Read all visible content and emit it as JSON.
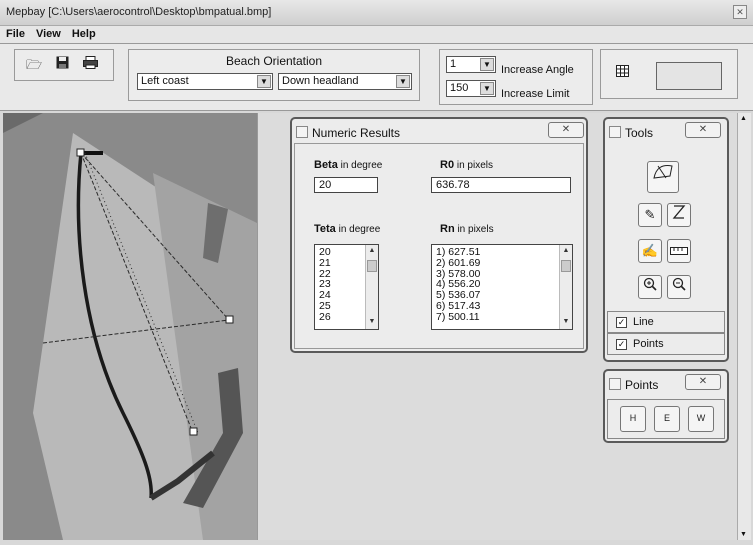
{
  "window": {
    "title": "Mepbay [C:\\Users\\aerocontrol\\Desktop\\bmpatual.bmp]"
  },
  "menu": [
    "File",
    "View",
    "Help"
  ],
  "beach_orientation": {
    "label": "Beach Orientation",
    "coast": "Left coast",
    "headland": "Down headland"
  },
  "angle_controls": {
    "angle_value": "1",
    "angle_label": "Increase Angle",
    "limit_value": "150",
    "limit_label": "Increase Limit"
  },
  "numeric_results": {
    "title": "Numeric Results",
    "beta_label": "Beta",
    "beta_unit": "in degree",
    "beta_value": "20",
    "r0_label": "R0",
    "r0_unit": "in pixels",
    "r0_value": "636.78",
    "teta_label": "Teta",
    "teta_unit": "in degree",
    "teta_list": [
      "20",
      "21",
      "22",
      "23",
      "24",
      "25",
      "26"
    ],
    "rn_label": "Rn",
    "rn_unit": "in pixels",
    "rn_list": [
      "1) 627.51",
      "2) 601.69",
      "3) 578.00",
      "4) 556.20",
      "5) 536.07",
      "6) 517.43",
      "7) 500.11"
    ]
  },
  "tools": {
    "title": "Tools",
    "line_label": "Line",
    "points_label": "Points",
    "line_checked": true,
    "points_checked": true
  },
  "points": {
    "title": "Points",
    "buttons": [
      "H",
      "E",
      "W"
    ]
  }
}
